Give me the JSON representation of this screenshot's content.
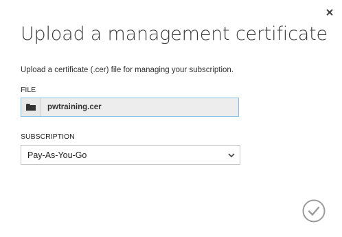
{
  "dialog": {
    "title": "Upload a management certificate",
    "description": "Upload a certificate (.cer) file for managing your subscription."
  },
  "file": {
    "label": "FILE",
    "value": "pwtraining.cer",
    "browse_icon": "folder-icon"
  },
  "subscription": {
    "label": "SUBSCRIPTION",
    "selected": "Pay-As-You-Go",
    "icon": "chevron-down-icon"
  },
  "actions": {
    "close_icon": "close-icon",
    "confirm_icon": "checkmark-icon"
  },
  "colors": {
    "accent_border": "#7fc3e8",
    "title_text": "#3a3a3a",
    "icon_gray": "#9a9a9a"
  }
}
